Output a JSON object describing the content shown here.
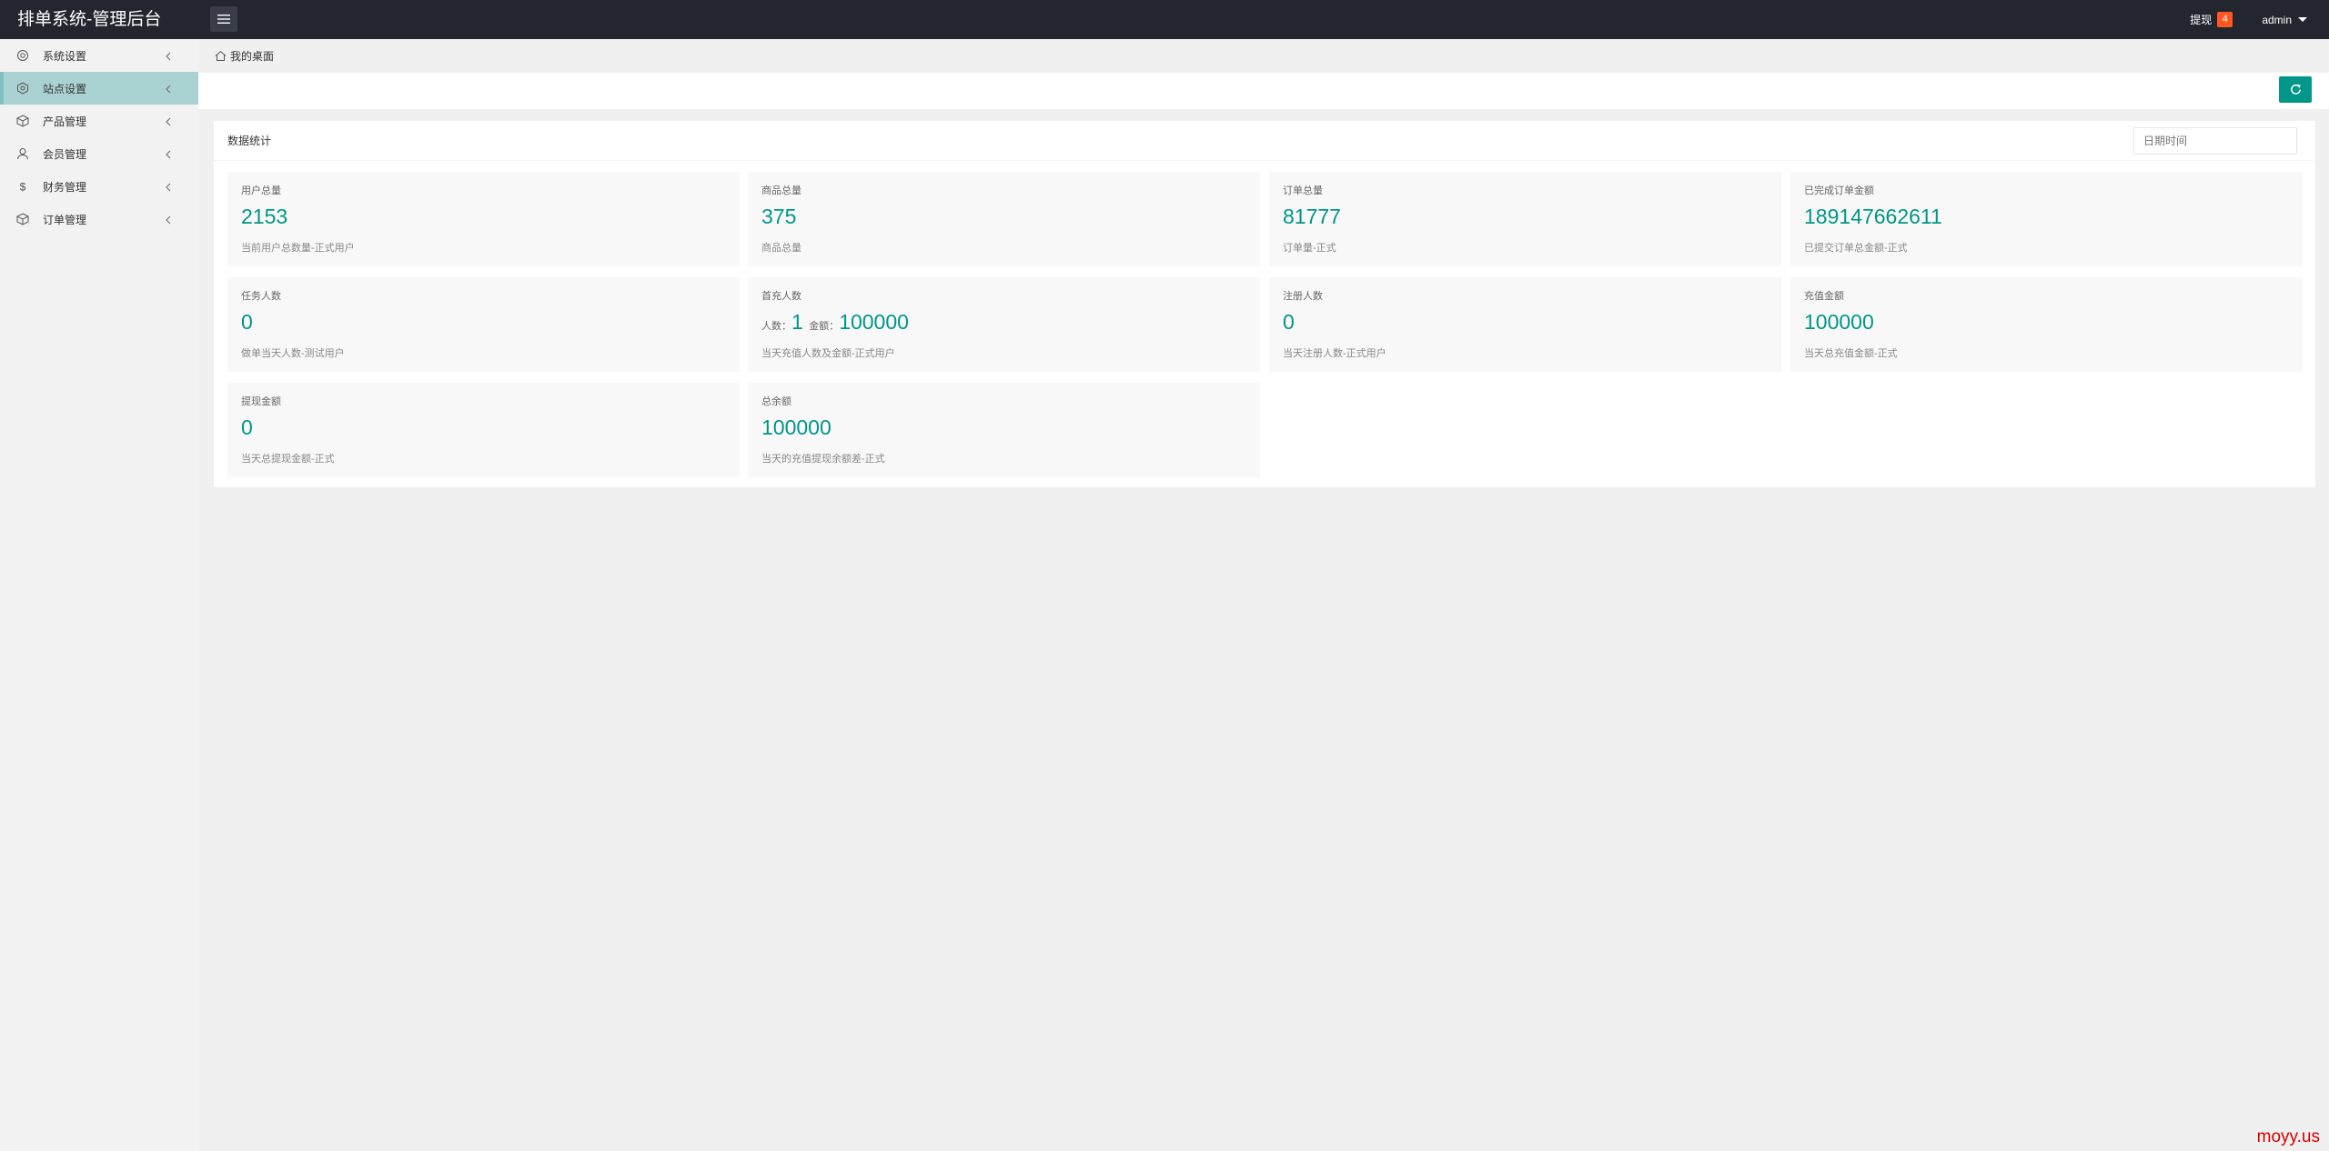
{
  "header": {
    "brand": "排单系统-管理后台",
    "withdraw_label": "提现",
    "withdraw_badge": "4",
    "user_label": "admin"
  },
  "sidebar": {
    "items": [
      {
        "label": "系统设置",
        "icon": "gear-icon",
        "active": false
      },
      {
        "label": "站点设置",
        "icon": "site-icon",
        "active": true
      },
      {
        "label": "产品管理",
        "icon": "box-icon",
        "active": false
      },
      {
        "label": "会员管理",
        "icon": "user-icon",
        "active": false
      },
      {
        "label": "财务管理",
        "icon": "dollar-icon",
        "active": false
      },
      {
        "label": "订单管理",
        "icon": "box-icon",
        "active": false
      }
    ]
  },
  "breadcrumb": {
    "label": "我的桌面"
  },
  "card": {
    "title": "数据统计",
    "date_placeholder": "日期时间"
  },
  "stats": [
    {
      "title": "用户总量",
      "value": "2153",
      "desc": "当前用户总数量-正式用户"
    },
    {
      "title": "商品总量",
      "value": "375",
      "desc": "商品总量"
    },
    {
      "title": "订单总量",
      "value": "81777",
      "desc": "订单量-正式"
    },
    {
      "title": "已完成订单金额",
      "value": "189147662611",
      "desc": "已提交订单总金额-正式"
    },
    {
      "title": "任务人数",
      "value": "0",
      "desc": "做单当天人数-测试用户"
    },
    {
      "title": "首充人数",
      "people_label": "人数：",
      "people_value": "1",
      "amount_label": "金额：",
      "amount_value": "100000",
      "desc": "当天充值人数及金额-正式用户"
    },
    {
      "title": "注册人数",
      "value": "0",
      "desc": "当天注册人数-正式用户"
    },
    {
      "title": "充值金额",
      "value": "100000",
      "desc": "当天总充值金额-正式"
    },
    {
      "title": "提现金额",
      "value": "0",
      "desc": "当天总提现金额-正式"
    },
    {
      "title": "总余额",
      "value": "100000",
      "desc": "当天的充值提现余额差-正式"
    }
  ],
  "watermark": "moyy.us",
  "colors": {
    "accent": "#009688",
    "topbar": "#23262e",
    "badge": "#ff5722",
    "active_nav": "#abd2d2"
  }
}
